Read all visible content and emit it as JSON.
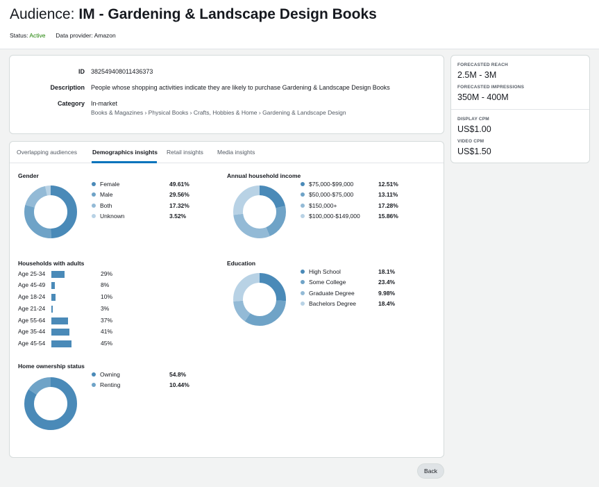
{
  "header": {
    "title_prefix": "Audience:",
    "title_name": "IM - Gardening & Landscape Design Books",
    "status_label": "Status:",
    "status_value": "Active",
    "provider_label": "Data provider:",
    "provider_value": "Amazon"
  },
  "info": {
    "id_label": "ID",
    "id_value": "382549408011436373",
    "description_label": "Description",
    "description_value": "People whose shopping activities indicate they are likely to purchase Gardening & Landscape Design Books",
    "category_label": "Category",
    "category_value": "In-market",
    "breadcrumb": "Books & Magazines › Physical Books › Crafts, Hobbies & Home › Gardening & Landscape Design"
  },
  "forecast": {
    "reach_label": "FORECASTED REACH",
    "reach_value": "2.5M - 3M",
    "impressions_label": "FORECASTED IMPRESSIONS",
    "impressions_value": "350M - 400M",
    "display_cpm_label": "DISPLAY CPM",
    "display_cpm_value": "US$1.00",
    "video_cpm_label": "VIDEO CPM",
    "video_cpm_value": "US$1.50"
  },
  "tabs": [
    {
      "label": "Overlapping audiences",
      "active": false
    },
    {
      "label": "Demographics insights",
      "active": true
    },
    {
      "label": "Retail insights",
      "active": false
    },
    {
      "label": "Media insights",
      "active": false
    }
  ],
  "colors": {
    "c1": "#4a8ab8",
    "c2": "#6fa3c7",
    "c3": "#93bad6",
    "c4": "#b8d2e5"
  },
  "gender": {
    "title": "Gender",
    "items": [
      {
        "label": "Female",
        "pct": "49.61%",
        "value": 49.61
      },
      {
        "label": "Male",
        "pct": "29.56%",
        "value": 29.56
      },
      {
        "label": "Both",
        "pct": "17.32%",
        "value": 17.32
      },
      {
        "label": "Unknown",
        "pct": "3.52%",
        "value": 3.52
      }
    ]
  },
  "income": {
    "title": "Annual household income",
    "items": [
      {
        "label": "$75,000-$99,000",
        "pct": "12.51%",
        "value": 12.51
      },
      {
        "label": "$50,000-$75,000",
        "pct": "13.11%",
        "value": 13.11
      },
      {
        "label": "$150,000+",
        "pct": "17.28%",
        "value": 17.28
      },
      {
        "label": "$100,000-$149,000",
        "pct": "15.86%",
        "value": 15.86
      }
    ]
  },
  "households": {
    "title": "Households with adults",
    "items": [
      {
        "label": "Age 25-34",
        "pct": "29%",
        "value": 29
      },
      {
        "label": "Age 45-49",
        "pct": "8%",
        "value": 8
      },
      {
        "label": "Age 18-24",
        "pct": "10%",
        "value": 10
      },
      {
        "label": "Age 21-24",
        "pct": "3%",
        "value": 3
      },
      {
        "label": "Age 55-64",
        "pct": "37%",
        "value": 37
      },
      {
        "label": "Age 35-44",
        "pct": "41%",
        "value": 41
      },
      {
        "label": "Age 45-54",
        "pct": "45%",
        "value": 45
      }
    ]
  },
  "education": {
    "title": "Education",
    "items": [
      {
        "label": "High School",
        "pct": "18.1%",
        "value": 18.1
      },
      {
        "label": "Some College",
        "pct": "23.4%",
        "value": 23.4
      },
      {
        "label": "Graduate Degree",
        "pct": "9.98%",
        "value": 9.98
      },
      {
        "label": "Bachelors Degree",
        "pct": "18.4%",
        "value": 18.4
      }
    ]
  },
  "home": {
    "title": "Home ownership status",
    "items": [
      {
        "label": "Owning",
        "pct": "54.8%",
        "value": 54.8
      },
      {
        "label": "Renting",
        "pct": "10.44%",
        "value": 10.44
      }
    ]
  },
  "back_label": "Back"
}
